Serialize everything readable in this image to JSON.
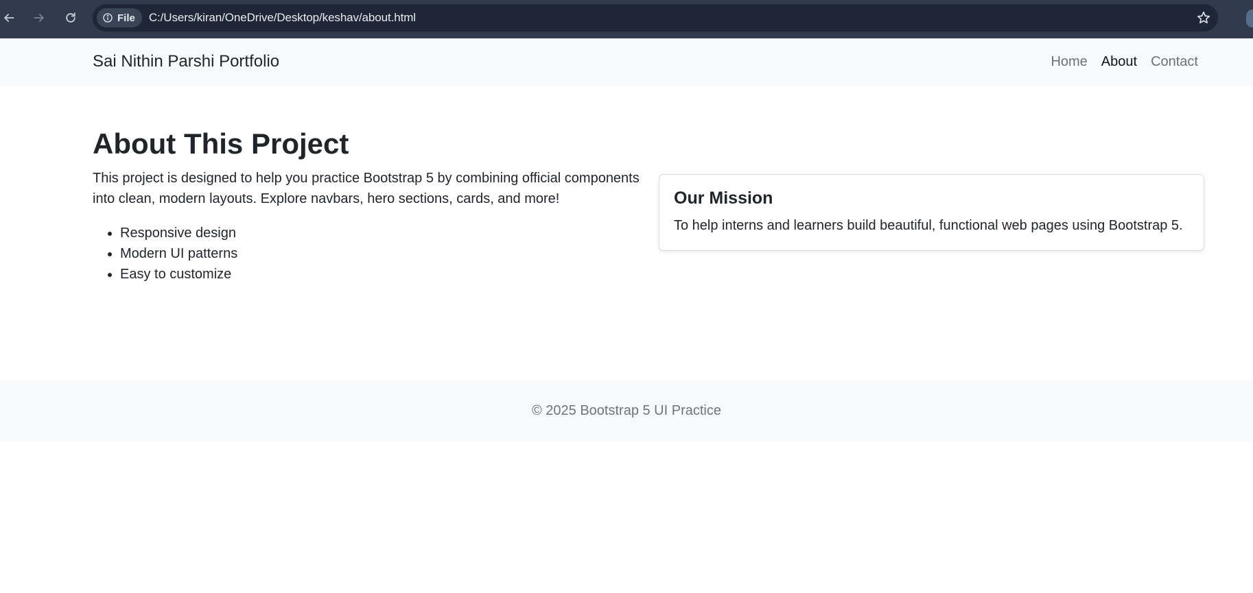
{
  "browser": {
    "scheme_chip": "File",
    "url": "C:/Users/kiran/OneDrive/Desktop/keshav/about.html"
  },
  "navbar": {
    "brand": "Sai Nithin Parshi Portfolio",
    "links": [
      {
        "label": "Home",
        "active": false
      },
      {
        "label": "About",
        "active": true
      },
      {
        "label": "Contact",
        "active": false
      }
    ]
  },
  "main": {
    "title": "About This Project",
    "intro": "This project is designed to help you practice Bootstrap 5 by combining official components into clean, modern layouts. Explore navbars, hero sections, cards, and more!",
    "features": [
      "Responsive design",
      "Modern UI patterns",
      "Easy to customize"
    ]
  },
  "card": {
    "title": "Our Mission",
    "text": "To help interns and learners build beautiful, functional web pages using Bootstrap 5."
  },
  "footer": {
    "text": "© 2025 Bootstrap 5 UI Practice"
  },
  "icons": {
    "back": "arrow-left-icon",
    "forward": "arrow-right-icon",
    "reload": "reload-icon",
    "info": "info-icon",
    "bookmark": "star-icon"
  },
  "colors": {
    "chrome_background": "#2f3a4c",
    "omnibox_background": "#1f2637",
    "navbar_background": "#f8f9fa",
    "footer_background": "#f8f9fa",
    "muted_text": "#6c757d"
  }
}
